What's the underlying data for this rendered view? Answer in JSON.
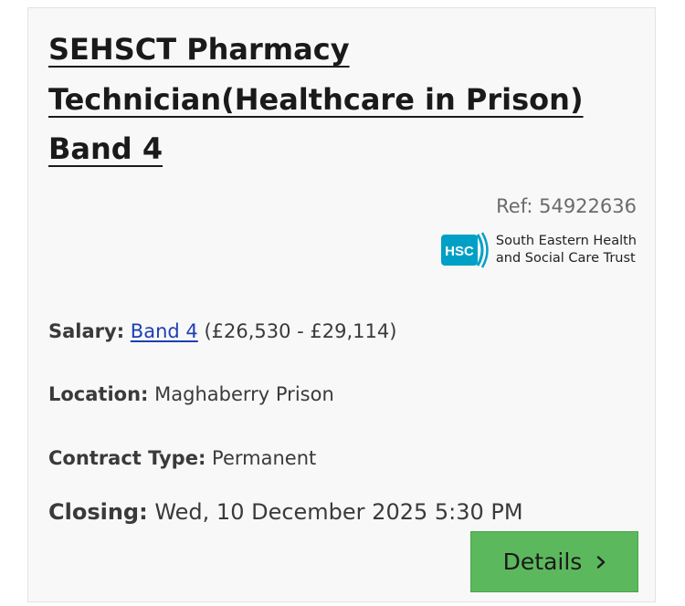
{
  "job": {
    "title_line1": "SEHSCT Pharmacy",
    "title_line2": "Technician(Healthcare in Prison)",
    "title_line3": "Band 4",
    "ref": "Ref: 54922636",
    "employer": {
      "logo_abbr": "HSC",
      "name_line1": "South Eastern Health",
      "name_line2": "and Social Care Trust",
      "brand_color": "#00a0c6"
    },
    "salary": {
      "label": "Salary:",
      "band_link": "Band 4",
      "range": "(£26,530 - £29,114)"
    },
    "location": {
      "label": "Location:",
      "value": "Maghaberry Prison"
    },
    "contract": {
      "label": "Contract Type:",
      "value": "Permanent"
    },
    "closing": {
      "label": "Closing:",
      "value": "Wed, 10 December 2025 5:30 PM"
    },
    "details_button": {
      "label": "Details",
      "icon": "chevron-right-icon",
      "color": "#5cb85c"
    }
  }
}
